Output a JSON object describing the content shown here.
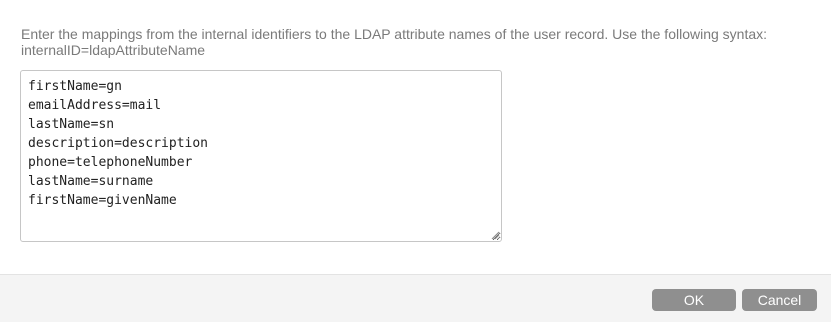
{
  "dialog": {
    "instructions": "Enter the mappings from the internal identifiers to the LDAP attribute names of the user record. Use the following syntax: internalID=ldapAttributeName",
    "mappings_value": "firstName=gn\nemailAddress=mail\nlastName=sn\ndescription=description\nphone=telephoneNumber\nlastName=surname\nfirstName=givenName",
    "ok_label": "OK",
    "cancel_label": "Cancel"
  },
  "colors": {
    "button_bg": "#8f8f8f",
    "footer_bg": "#f4f4f4",
    "instruction_text": "#7a7a7a"
  },
  "icons": {
    "resize_grip": "resize-grip-icon"
  }
}
